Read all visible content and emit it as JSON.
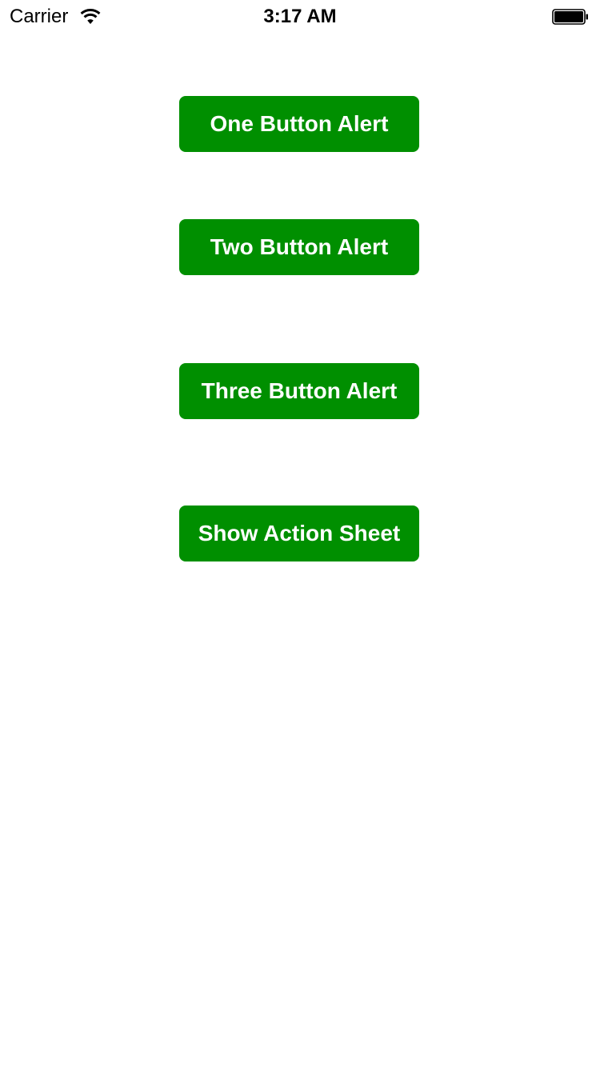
{
  "status_bar": {
    "carrier": "Carrier",
    "time": "3:17 AM",
    "wifi_icon": "wifi-icon",
    "battery_icon": "battery-icon",
    "battery_level": 1.0
  },
  "theme": {
    "button_color": "#008F00",
    "button_text_color": "#FFFFFF",
    "background": "#FFFFFF"
  },
  "buttons": [
    {
      "label": "One Button Alert"
    },
    {
      "label": "Two Button Alert"
    },
    {
      "label": "Three Button Alert"
    },
    {
      "label": "Show Action Sheet"
    }
  ]
}
